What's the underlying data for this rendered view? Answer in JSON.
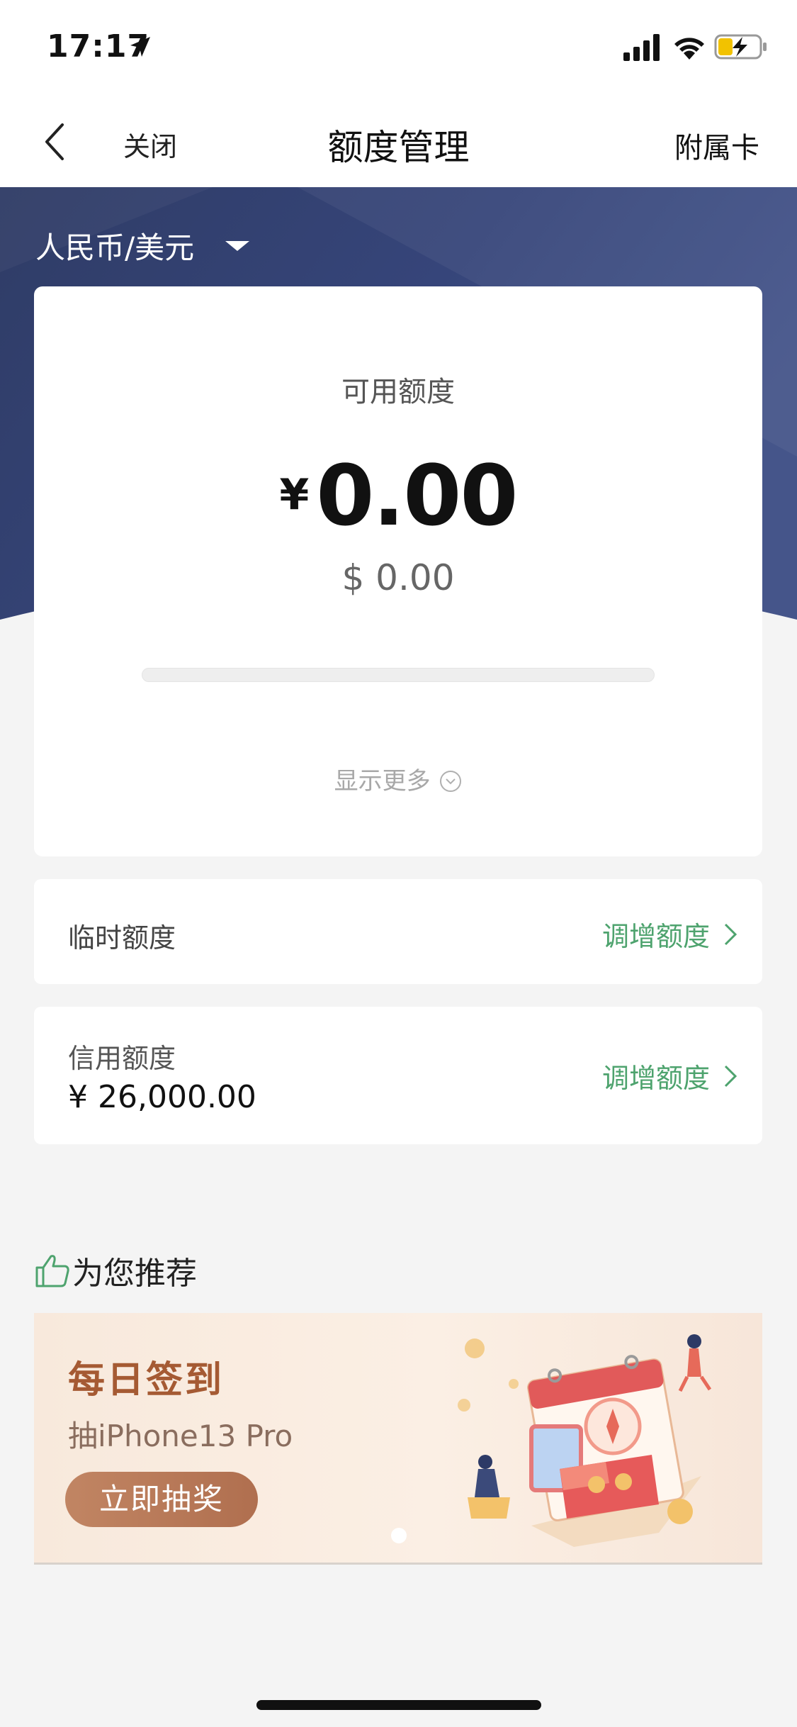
{
  "status_bar": {
    "time": "17:17",
    "battery_charging": true
  },
  "nav": {
    "close_label": "关闭",
    "title": "额度管理",
    "right_label": "附属卡"
  },
  "currency_selector": {
    "label": "人民币/美元"
  },
  "available": {
    "label": "可用额度",
    "cny_symbol": "¥",
    "cny_value": "0.00",
    "usd_value": "$ 0.00",
    "usage_fraction": 0.0,
    "show_more_label": "显示更多"
  },
  "temp_limit": {
    "label": "临时额度",
    "action_label": "调增额度"
  },
  "credit_limit": {
    "label": "信用额度",
    "value": "¥ 26,000.00",
    "action_label": "调增额度"
  },
  "recommend": {
    "title": "为您推荐",
    "promo": {
      "title": "每日签到",
      "subtitle": "抽iPhone13 Pro",
      "button_label": "立即抽奖"
    }
  },
  "colors": {
    "accent_green": "#4ea36e",
    "hero_blue": "#33426f",
    "promo_brown": "#a55a33"
  }
}
